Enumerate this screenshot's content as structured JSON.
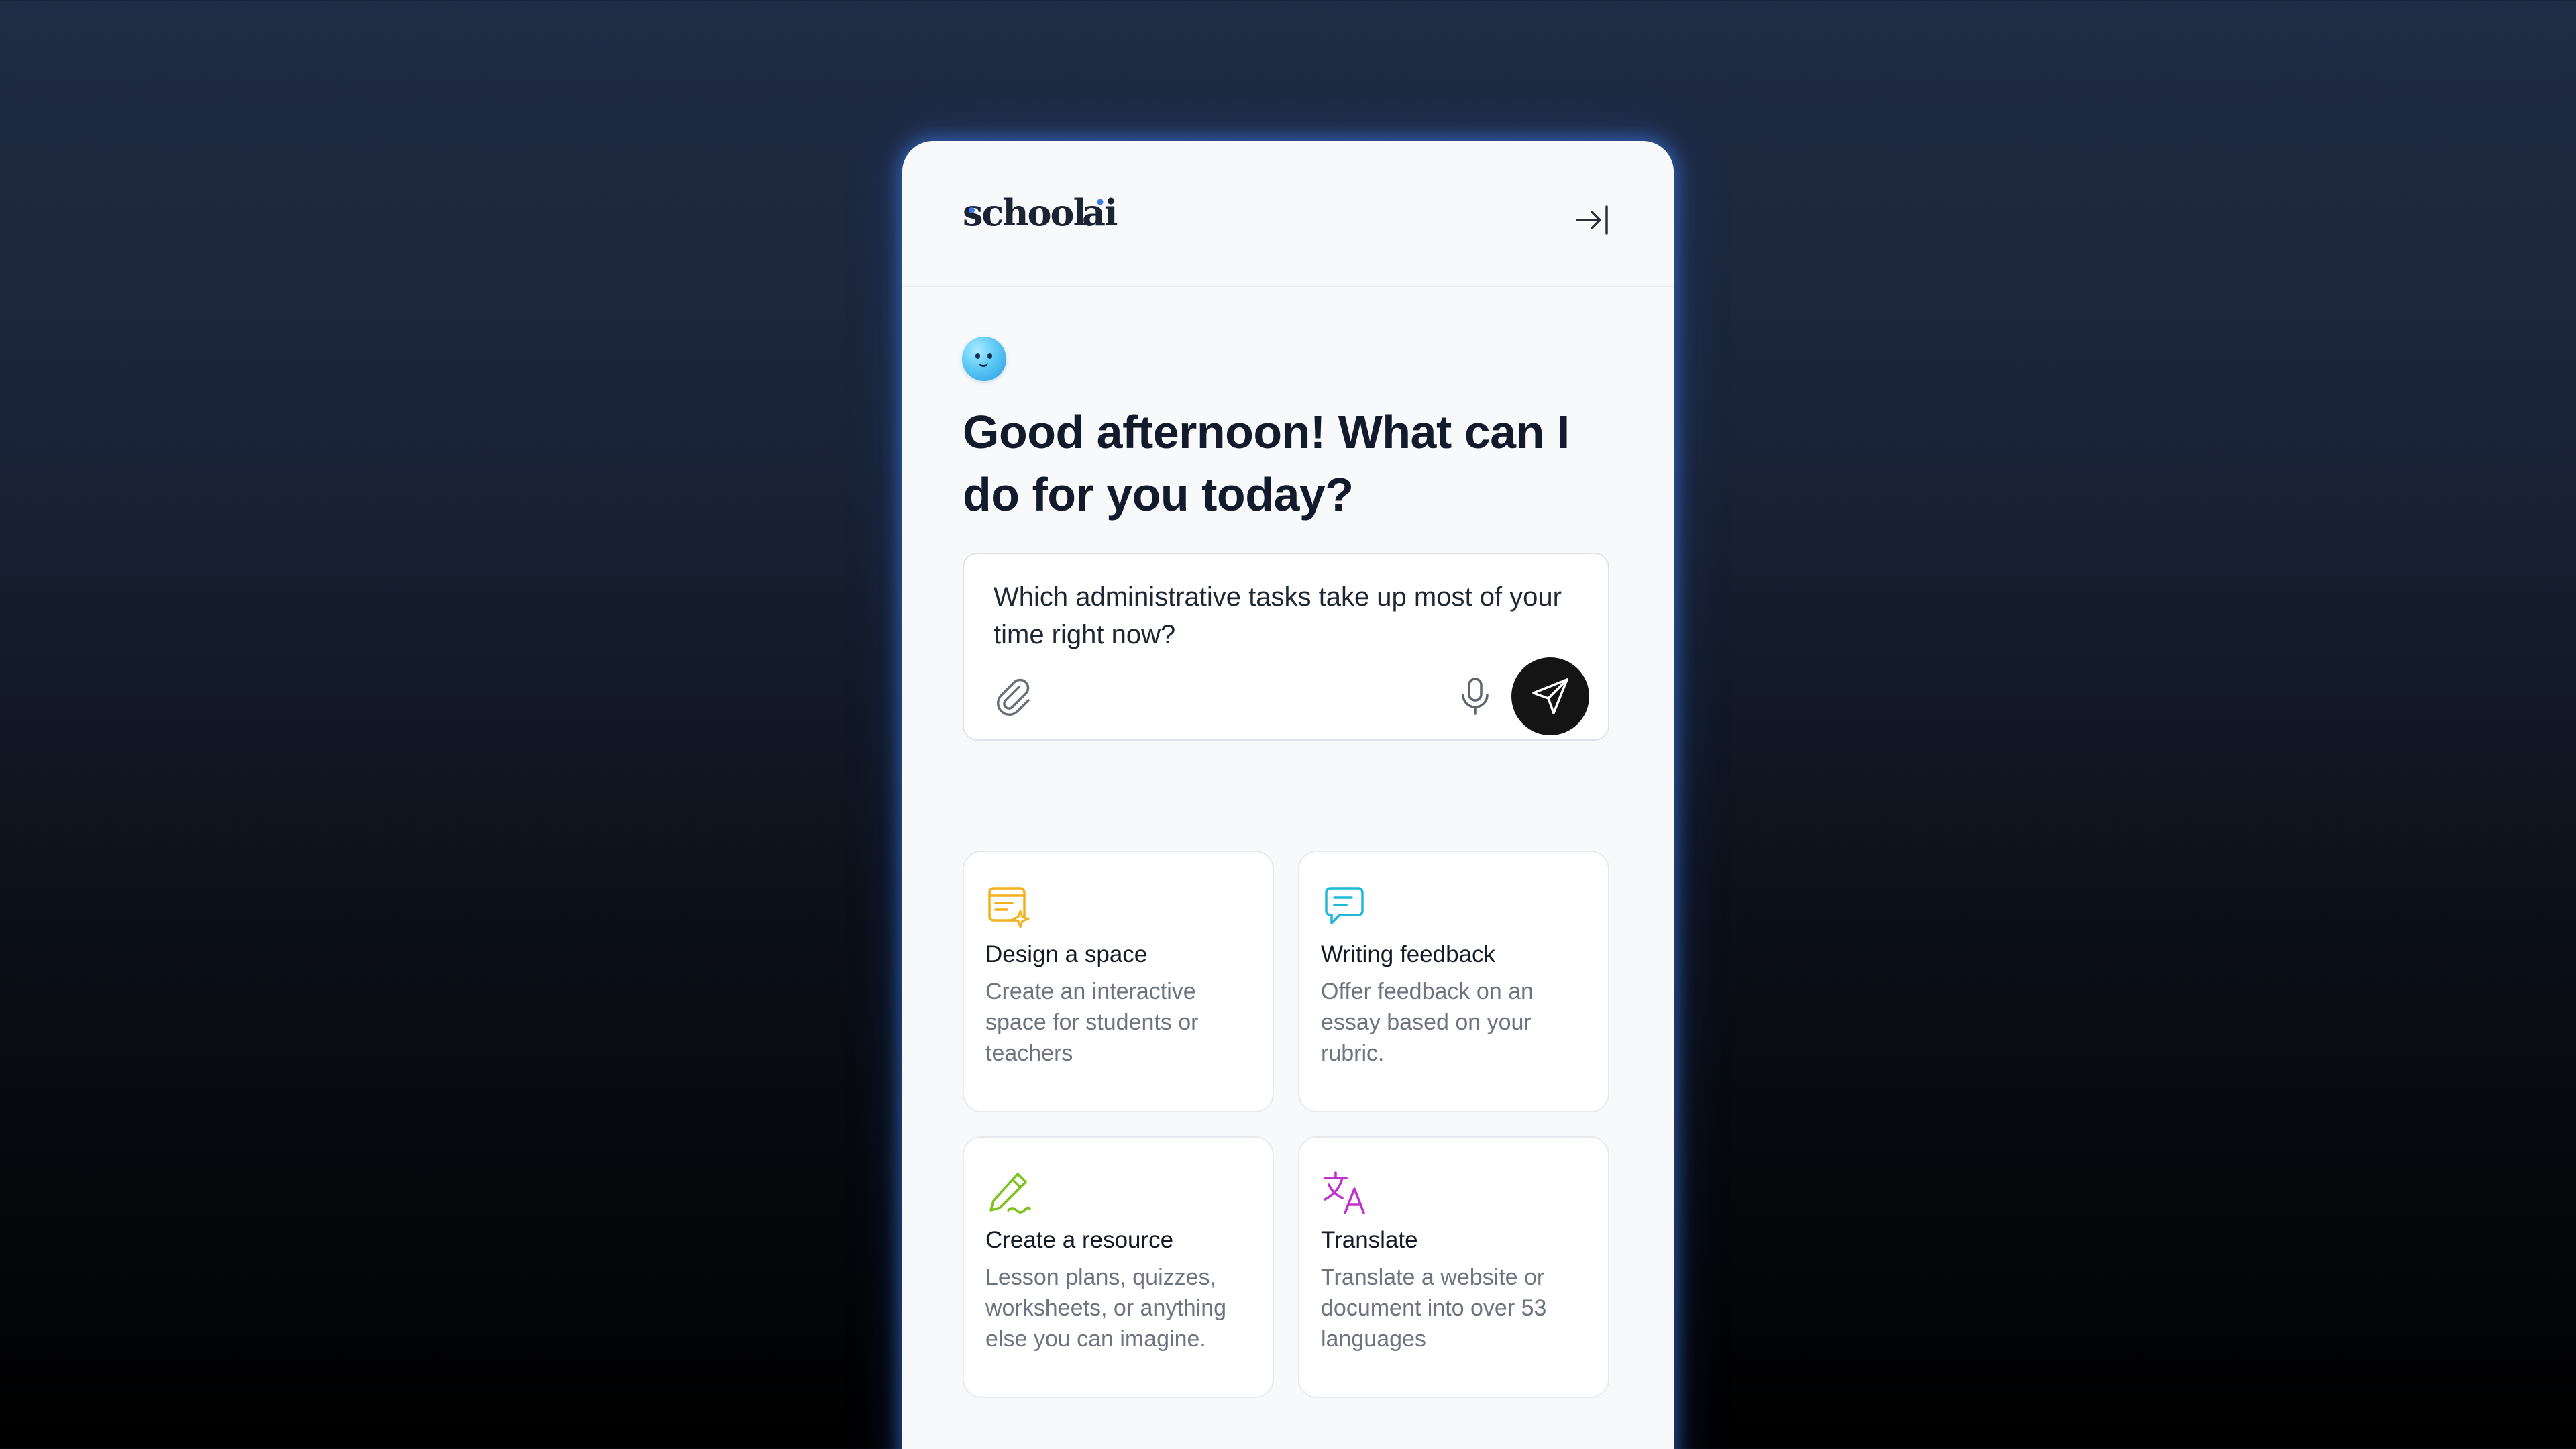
{
  "app": {
    "logo_text": "school ai",
    "brand_color": "#3b7de8"
  },
  "header": {
    "collapse_icon": "collapse-right-icon"
  },
  "main": {
    "greeting": "Good afternoon! What can I do for you today?",
    "prompt": {
      "value": "Which administrative tasks take up most of your time right now?",
      "attach_icon": "paperclip-icon",
      "mic_icon": "microphone-icon",
      "send_icon": "send-icon"
    },
    "cards": [
      {
        "title": "Design a space",
        "description": "Create an interactive space for students or teachers",
        "icon": "design-space-icon",
        "color": "#f2b11d"
      },
      {
        "title": "Writing feedback",
        "description": "Offer feedback on an essay based on your rubric.",
        "icon": "chat-feedback-icon",
        "color": "#1fb8d6"
      },
      {
        "title": "Create a resource",
        "description": "Lesson plans, quizzes, worksheets, or anything else you can imagine.",
        "icon": "pencil-icon",
        "color": "#7cc21c"
      },
      {
        "title": "Translate",
        "description": "Translate a website or document into over 53 languages",
        "icon": "translate-icon",
        "color": "#c22fcf"
      }
    ]
  }
}
